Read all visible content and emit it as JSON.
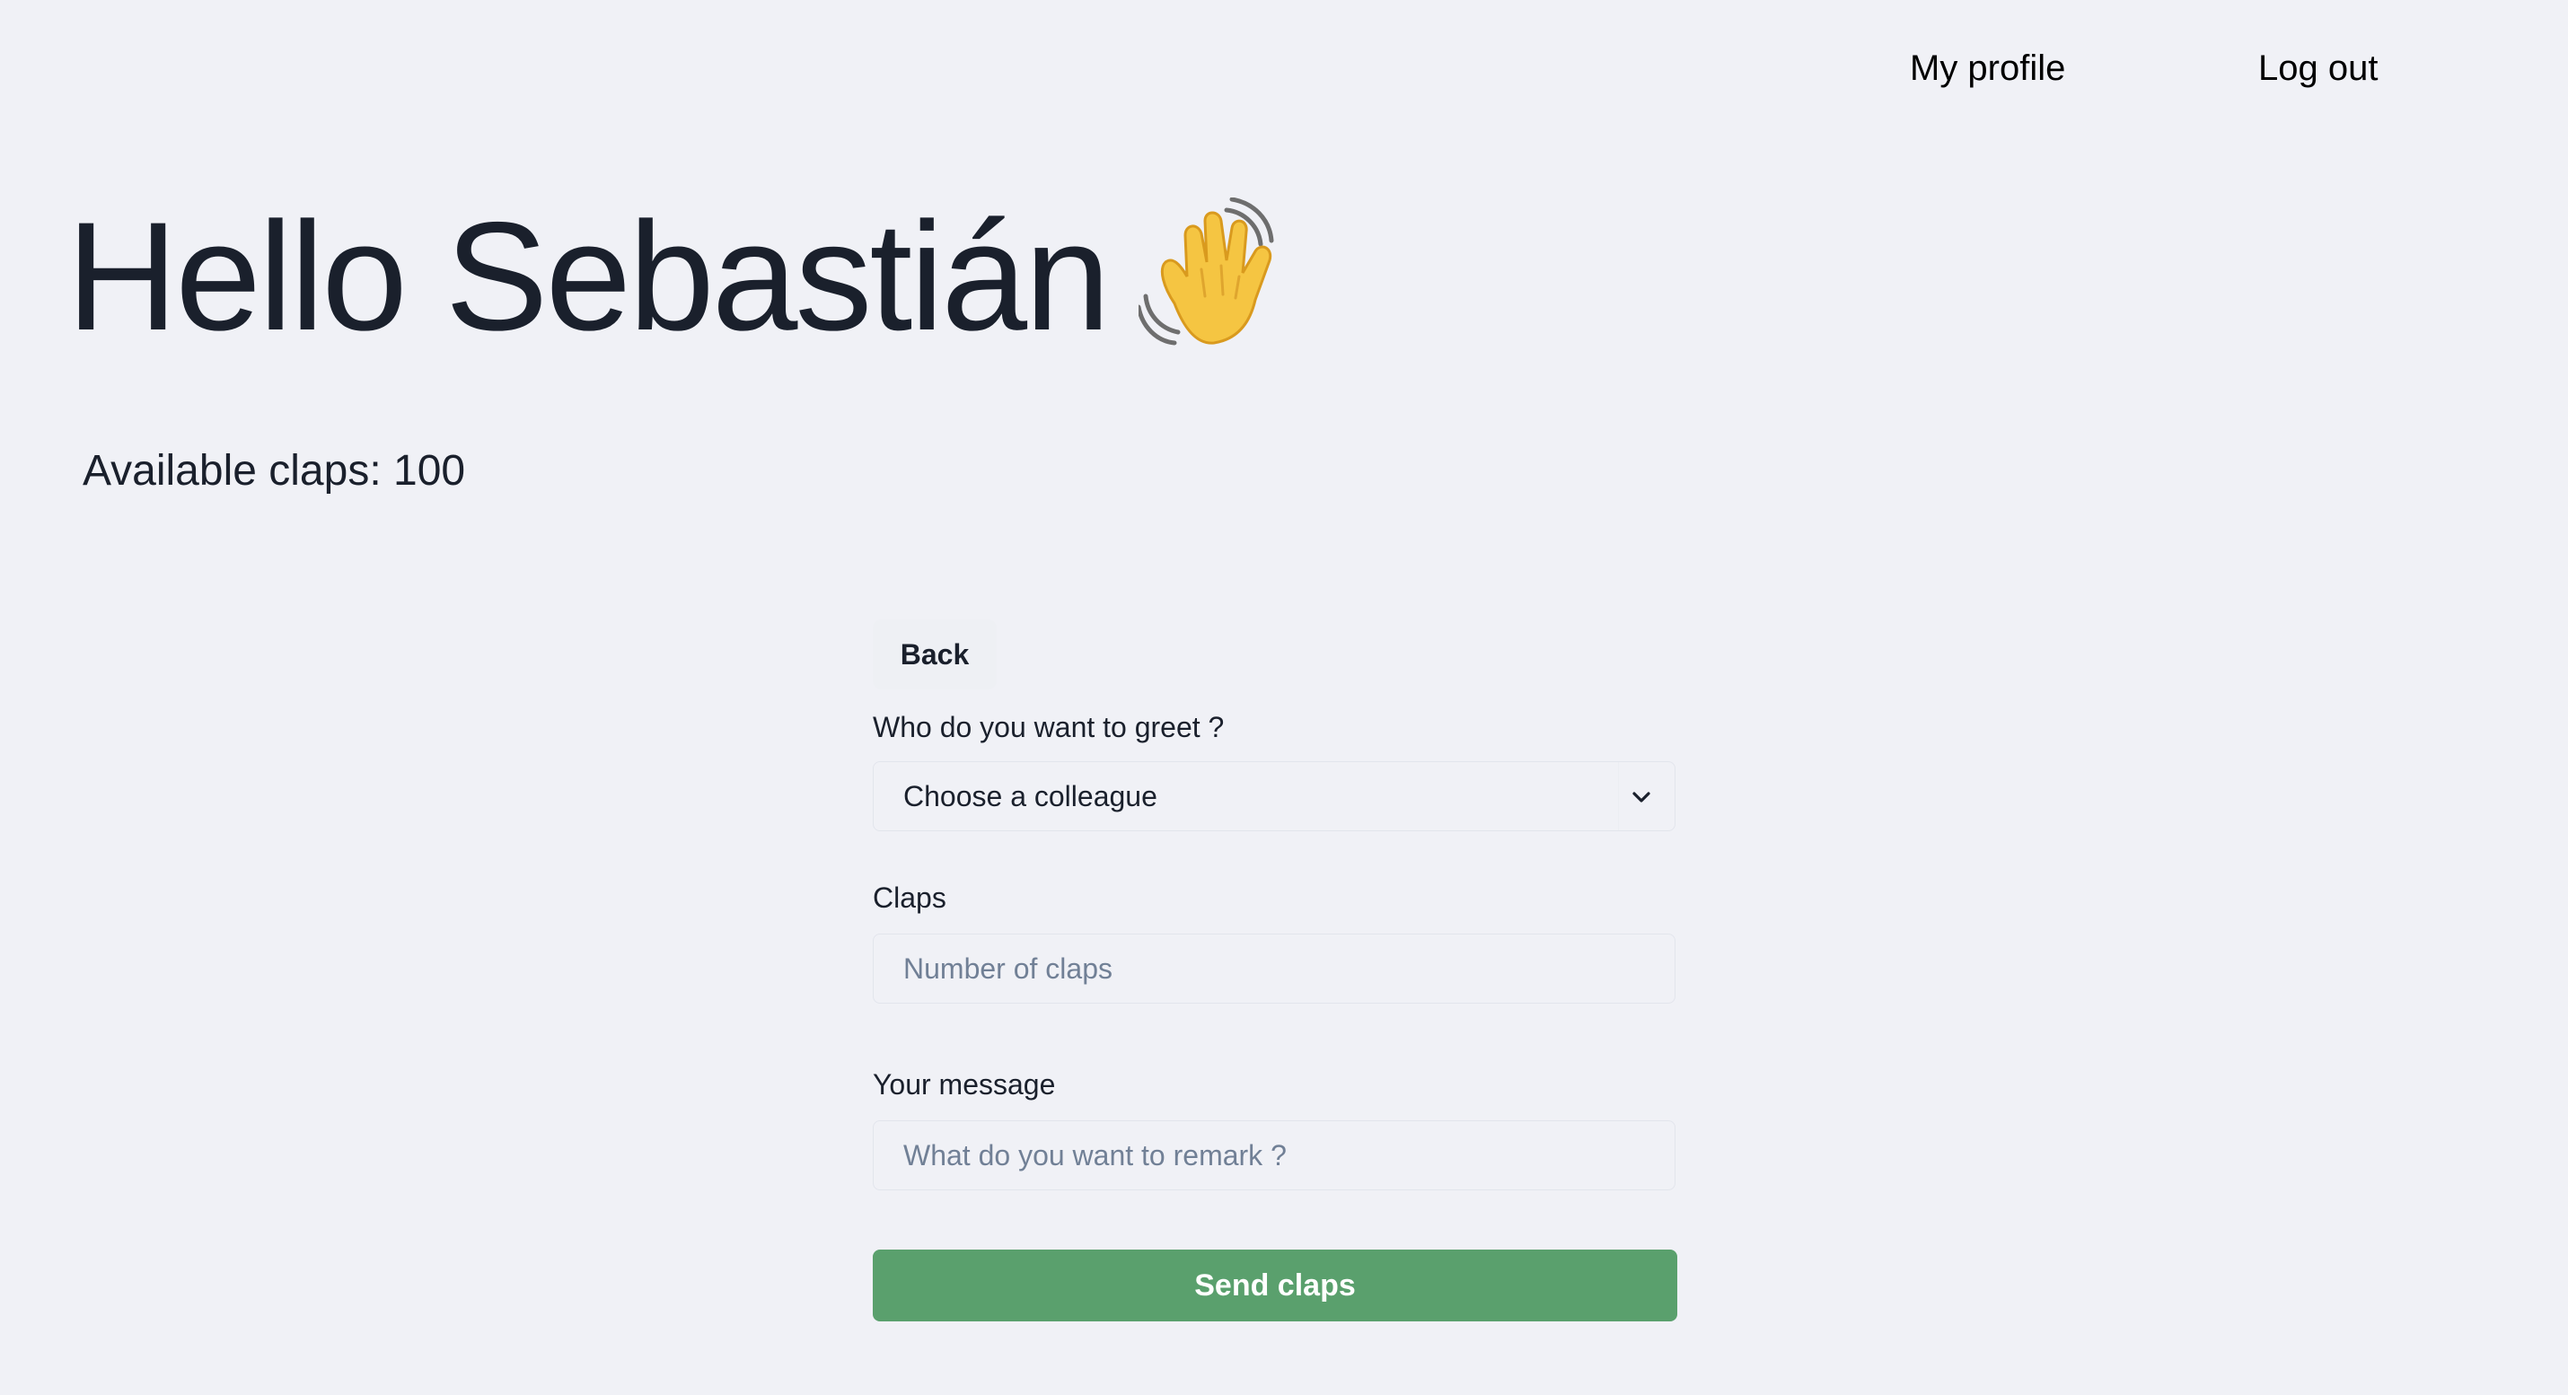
{
  "nav": {
    "profile_label": "My profile",
    "logout_label": "Log out"
  },
  "greeting": {
    "text": "Hello Sebastián",
    "icon": "waving-hand-icon"
  },
  "claps": {
    "label": "Available claps:",
    "value": "100"
  },
  "form": {
    "back_label": "Back",
    "recipient_label": "Who do you want to greet ?",
    "recipient_selected": "Choose a colleague",
    "claps_label": "Claps",
    "claps_placeholder": "Number of claps",
    "message_label": "Your message",
    "message_placeholder": "What do you want to remark ?",
    "submit_label": "Send claps"
  },
  "colors": {
    "background": "#f0f1f6",
    "primary_button": "#5aa06d",
    "text": "#1a202c",
    "placeholder": "#718096"
  }
}
